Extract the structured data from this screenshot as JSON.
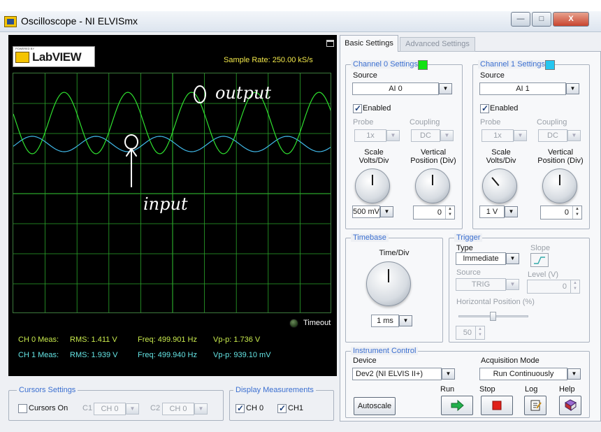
{
  "window": {
    "title": "Oscilloscope - NI ELVISmx",
    "minimize": "—",
    "maximize": "□",
    "close": "X"
  },
  "scope": {
    "logo_text": "LabVIEW",
    "logo_small": "POWERED BY",
    "sample_rate": "Sample Rate:  250.00 kS/s",
    "annotations": {
      "output": "O output",
      "input": "input"
    },
    "timeout_label": "Timeout",
    "measurements": [
      {
        "label": "CH 0 Meas:",
        "rms": "RMS:  1.411 V",
        "freq": "Freq:  499.901 Hz",
        "vpp": "Vp-p:  1.736 V"
      },
      {
        "label": "CH 1 Meas:",
        "rms": "RMS:  1.939 V",
        "freq": "Freq:  499.940 Hz",
        "vpp": "Vp-p:  939.10 mV"
      }
    ],
    "colors": {
      "ch0": "#2fe02f",
      "ch1": "#40b8e8",
      "grid": "#2aa52a"
    }
  },
  "cursors": {
    "title": "Cursors Settings",
    "cursors_on_label": "Cursors On",
    "c1_label": "C1",
    "c1_value": "CH 0",
    "c2_label": "C2",
    "c2_value": "CH 0"
  },
  "display": {
    "title": "Display Measurements",
    "ch0_label": "CH 0",
    "ch1_label": "CH1"
  },
  "tabs": {
    "basic": "Basic Settings",
    "advanced": "Advanced Settings"
  },
  "channel0": {
    "title": "Channel 0 Settings",
    "color": "#11e311",
    "source_label": "Source",
    "source": "AI 0",
    "enabled_label": "Enabled",
    "probe_label": "Probe",
    "probe": "1x",
    "coupling_label": "Coupling",
    "coupling": "DC",
    "scale_label": "Scale\nVolts/Div",
    "vpos_label": "Vertical\nPosition (Div)",
    "scale": "500 mV",
    "vpos": "0"
  },
  "channel1": {
    "title": "Channel 1 Settings",
    "color": "#25c6f0",
    "source_label": "Source",
    "source": "AI 1",
    "enabled_label": "Enabled",
    "probe_label": "Probe",
    "probe": "1x",
    "coupling_label": "Coupling",
    "coupling": "DC",
    "scale_label": "Scale\nVolts/Div",
    "vpos_label": "Vertical\nPosition (Div)",
    "scale": "1 V",
    "vpos": "0"
  },
  "timebase": {
    "title": "Timebase",
    "time_div_label": "Time/Div",
    "time_div": "1 ms"
  },
  "trigger": {
    "title": "Trigger",
    "type_label": "Type",
    "type": "Immediate",
    "slope_label": "Slope",
    "source_label": "Source",
    "source": "TRIG",
    "level_label": "Level (V)",
    "level": "0",
    "hpos_label": "Horizontal Position (%)",
    "hpos": "50",
    "hpos_percent": 50
  },
  "instrument": {
    "title": "Instrument Control",
    "device_label": "Device",
    "device": "Dev2 (NI ELVIS II+)",
    "acq_label": "Acquisition Mode",
    "acq": "Run Continuously",
    "autoscale": "Autoscale",
    "run_label": "Run",
    "stop_label": "Stop",
    "log_label": "Log",
    "help_label": "Help"
  }
}
